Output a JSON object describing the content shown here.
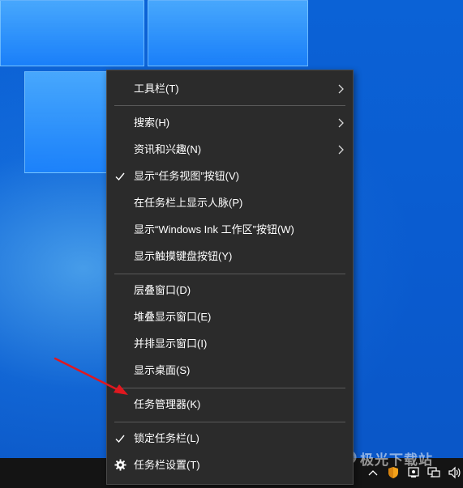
{
  "menu": {
    "items": [
      {
        "label": "工具栏(T)",
        "has_submenu": true,
        "checked": false
      },
      {
        "label": "搜索(H)",
        "has_submenu": true,
        "checked": false
      },
      {
        "label": "资讯和兴趣(N)",
        "has_submenu": true,
        "checked": false
      },
      {
        "label": "显示“任务视图”按钮(V)",
        "has_submenu": false,
        "checked": true
      },
      {
        "label": "在任务栏上显示人脉(P)",
        "has_submenu": false,
        "checked": false
      },
      {
        "label": "显示“Windows Ink 工作区”按钮(W)",
        "has_submenu": false,
        "checked": false
      },
      {
        "label": "显示触摸键盘按钮(Y)",
        "has_submenu": false,
        "checked": false
      },
      {
        "label": "层叠窗口(D)",
        "has_submenu": false,
        "checked": false
      },
      {
        "label": "堆叠显示窗口(E)",
        "has_submenu": false,
        "checked": false
      },
      {
        "label": "并排显示窗口(I)",
        "has_submenu": false,
        "checked": false
      },
      {
        "label": "显示桌面(S)",
        "has_submenu": false,
        "checked": false
      },
      {
        "label": "任务管理器(K)",
        "has_submenu": false,
        "checked": false
      },
      {
        "label": "锁定任务栏(L)",
        "has_submenu": false,
        "checked": true
      },
      {
        "label": "任务栏设置(T)",
        "has_submenu": false,
        "checked": false,
        "icon": "gear-icon"
      }
    ]
  },
  "tray": {
    "icons": [
      "chevron-up-icon",
      "shield-icon",
      "network-tray-icon",
      "display-icon",
      "speaker-icon"
    ]
  },
  "watermark": {
    "text": "极光下载站",
    "icon": "watermark-logo-icon"
  },
  "colors": {
    "menu_bg": "#2b2b2b",
    "desktop_blue": "#0a58c9",
    "annotation_arrow": "#e0181f"
  }
}
